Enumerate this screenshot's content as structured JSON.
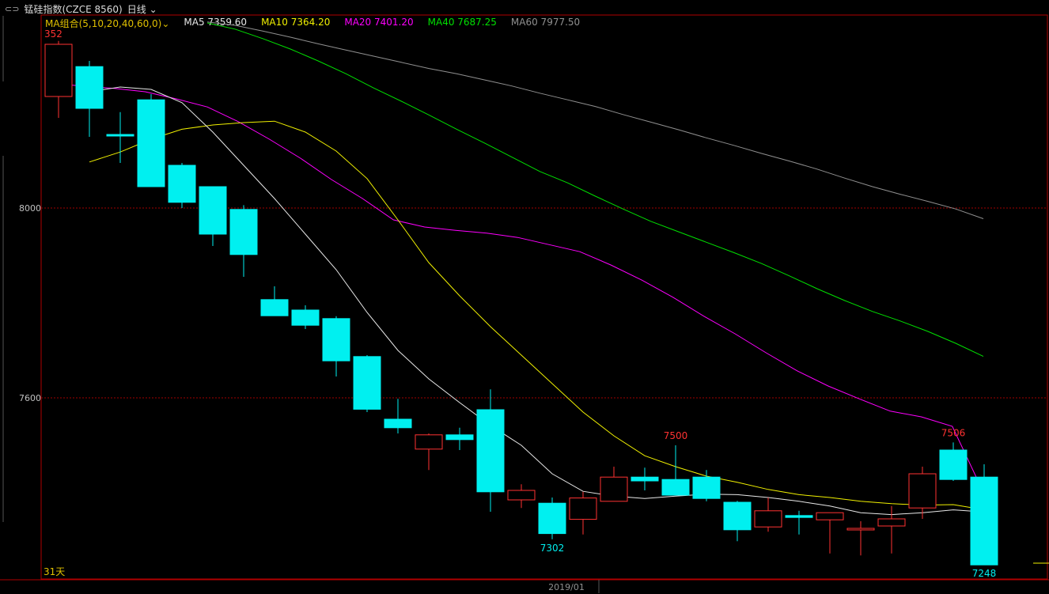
{
  "header": {
    "link_icon": "link-icon",
    "title": "锰硅指数(CZCE 8560)",
    "period": "日线",
    "period_arrow_icon": "chevron-down-icon"
  },
  "legend": {
    "group_label": "MA组合(5,10,20,40,60,0)",
    "items": [
      {
        "text": "MA5 7359.60",
        "color": "#e8e8e8"
      },
      {
        "text": "MA10 7364.20",
        "color": "#f0f000"
      },
      {
        "text": "MA20 7401.20",
        "color": "#ff00ff"
      },
      {
        "text": "MA40 7687.25",
        "color": "#00e000"
      },
      {
        "text": "MA60 7977.50",
        "color": "#909090"
      }
    ]
  },
  "colors": {
    "up": "#ff3232",
    "down": "#00f0f0",
    "grid": "#a00000",
    "frame": "#b00000",
    "axis_text": "#c0c0c0"
  },
  "chart_data": {
    "type": "candlestick",
    "y_ticks": [
      8000,
      7600
    ],
    "y_tick_labels": [
      "8000",
      "7600"
    ],
    "x_tick_labels": [
      "2019/01"
    ],
    "candles": [
      {
        "o": 8235,
        "h": 8352,
        "l": 8190,
        "c": 8345
      },
      {
        "o": 8298,
        "h": 8310,
        "l": 8150,
        "c": 8210
      },
      {
        "o": 8155,
        "h": 8202,
        "l": 8095,
        "c": 8154
      },
      {
        "o": 8228,
        "h": 8240,
        "l": 8045,
        "c": 8045
      },
      {
        "o": 8090,
        "h": 8095,
        "l": 8000,
        "c": 8012
      },
      {
        "o": 8045,
        "h": 8045,
        "l": 7920,
        "c": 7945
      },
      {
        "o": 7997,
        "h": 8006,
        "l": 7855,
        "c": 7902
      },
      {
        "o": 7807,
        "h": 7835,
        "l": 7775,
        "c": 7773
      },
      {
        "o": 7785,
        "h": 7795,
        "l": 7745,
        "c": 7753
      },
      {
        "o": 7767,
        "h": 7772,
        "l": 7645,
        "c": 7678
      },
      {
        "o": 7687,
        "h": 7690,
        "l": 7570,
        "c": 7576
      },
      {
        "o": 7555,
        "h": 7598,
        "l": 7525,
        "c": 7537
      },
      {
        "o": 7492,
        "h": 7525,
        "l": 7448,
        "c": 7522
      },
      {
        "o": 7522,
        "h": 7537,
        "l": 7490,
        "c": 7512
      },
      {
        "o": 7575,
        "h": 7618,
        "l": 7360,
        "c": 7402
      },
      {
        "o": 7385,
        "h": 7418,
        "l": 7368,
        "c": 7405
      },
      {
        "o": 7378,
        "h": 7390,
        "l": 7302,
        "c": 7314
      },
      {
        "o": 7344,
        "h": 7402,
        "l": 7312,
        "c": 7389
      },
      {
        "o": 7382,
        "h": 7455,
        "l": 7382,
        "c": 7433
      },
      {
        "o": 7433,
        "h": 7453,
        "l": 7405,
        "c": 7425
      },
      {
        "o": 7428,
        "h": 7500,
        "l": 7395,
        "c": 7395
      },
      {
        "o": 7433,
        "h": 7448,
        "l": 7382,
        "c": 7388
      },
      {
        "o": 7380,
        "h": 7383,
        "l": 7298,
        "c": 7322
      },
      {
        "o": 7328,
        "h": 7390,
        "l": 7318,
        "c": 7362
      },
      {
        "o": 7352,
        "h": 7362,
        "l": 7312,
        "c": 7348
      },
      {
        "o": 7343,
        "h": 7355,
        "l": 7272,
        "c": 7358
      },
      {
        "o": 7325,
        "h": 7340,
        "l": 7268,
        "c": 7325
      },
      {
        "o": 7330,
        "h": 7372,
        "l": 7272,
        "c": 7345
      },
      {
        "o": 7368,
        "h": 7455,
        "l": 7345,
        "c": 7440
      },
      {
        "o": 7490,
        "h": 7506,
        "l": 7425,
        "c": 7428
      },
      {
        "o": 7433,
        "h": 7460,
        "l": 7248,
        "c": 7248
      }
    ],
    "series": [
      {
        "name": "MA5",
        "color": "#e8e8e8",
        "values": [
          null,
          8245,
          8255,
          8250,
          8222,
          8160,
          8090,
          8020,
          7945,
          7870,
          7780,
          7700,
          7640,
          7590,
          7542,
          7500,
          7440,
          7403,
          7393,
          7388,
          7393,
          7397,
          7396,
          7390,
          7382,
          7372,
          7358,
          7354,
          7358,
          7364,
          7359.6
        ]
      },
      {
        "name": "MA10",
        "color": "#f0f000",
        "values": [
          null,
          8097,
          8118,
          8145,
          8166,
          8175,
          8180,
          8183,
          8160,
          8120,
          8062,
          7975,
          7885,
          7815,
          7750,
          7690,
          7630,
          7570,
          7520,
          7478,
          7455,
          7435,
          7422,
          7407,
          7396,
          7390,
          7382,
          7377,
          7374,
          7375,
          7364.2
        ]
      },
      {
        "name": "MA20",
        "color": "#ff00ff",
        "values": [
          null,
          8262,
          8257,
          8252,
          8245,
          8230,
          8213,
          8182,
          8145,
          8105,
          8060,
          8020,
          7975,
          7960,
          7953,
          7947,
          7938,
          7923,
          7908,
          7880,
          7848,
          7812,
          7772,
          7735,
          7695,
          7657,
          7625,
          7598,
          7572,
          7560,
          7540,
          7401.2
        ]
      },
      {
        "name": "MA40",
        "color": "#00e000",
        "values": [
          null,
          null,
          null,
          null,
          null,
          null,
          8390,
          8377,
          8357,
          8335,
          8310,
          8283,
          8253,
          8225,
          8196,
          8166,
          8137,
          8107,
          8077,
          8053,
          8025,
          7998,
          7972,
          7950,
          7928,
          7906,
          7883,
          7857,
          7830,
          7805,
          7782,
          7762,
          7740,
          7715,
          7687.25
        ]
      },
      {
        "name": "MA60",
        "color": "#909090",
        "values": [
          null,
          null,
          null,
          null,
          null,
          null,
          8392,
          8385,
          8373,
          8360,
          8346,
          8333,
          8320,
          8307,
          8294,
          8283,
          8270,
          8257,
          8242,
          8228,
          8214,
          8197,
          8181,
          8165,
          8148,
          8132,
          8115,
          8099,
          8082,
          8063,
          8045,
          8029,
          8014,
          7998,
          7977.5
        ]
      }
    ],
    "annotations": [
      {
        "text": "352",
        "color": "#ff3232",
        "at": "high-start"
      },
      {
        "text": "7302",
        "color": "#00f0f0",
        "at": 16
      },
      {
        "text": "7500",
        "color": "#ff3232",
        "at": 20
      },
      {
        "text": "7506",
        "color": "#ff3232",
        "at": 29
      },
      {
        "text": "7248",
        "color": "#00f0f0",
        "at": 30
      }
    ],
    "period_label": "31天"
  }
}
